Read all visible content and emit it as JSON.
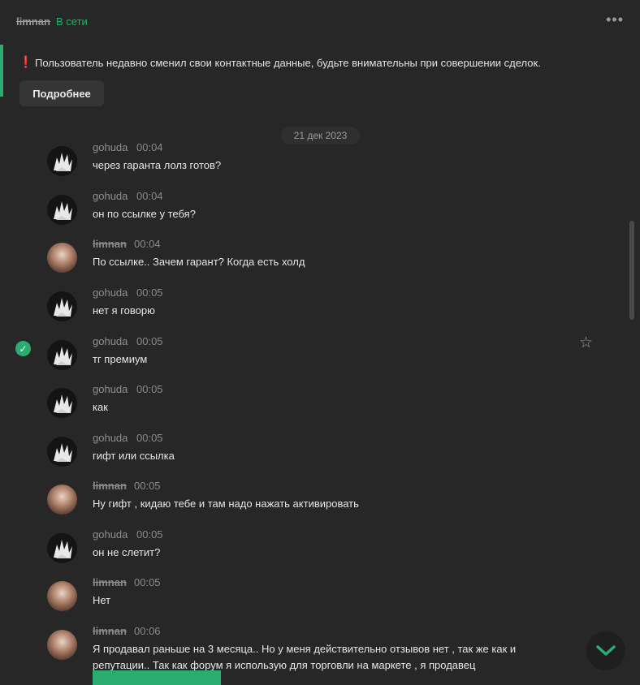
{
  "header": {
    "username": "limnan",
    "status": "В сети",
    "menu_icon": "more-dots-icon"
  },
  "notice": {
    "icon": "exclamation-icon",
    "text": "Пользователь недавно сменил свои контактные данные, будьте внимательны при совершении сделок.",
    "button_label": "Подробнее"
  },
  "date_separator": "21 дек 2023",
  "messages": [
    {
      "author": "gohuda",
      "time": "00:04",
      "text": "через гаранта лолз готов?"
    },
    {
      "author": "gohuda",
      "time": "00:04",
      "text": "он по ссылке у тебя?"
    },
    {
      "author": "limnan",
      "time": "00:04",
      "text": "По ссылке.. Зачем гарант? Когда есть холд"
    },
    {
      "author": "gohuda",
      "time": "00:05",
      "text": "нет я говорю"
    },
    {
      "author": "gohuda",
      "time": "00:05",
      "text": "тг премиум"
    },
    {
      "author": "gohuda",
      "time": "00:05",
      "text": "как"
    },
    {
      "author": "gohuda",
      "time": "00:05",
      "text": "гифт или ссылка"
    },
    {
      "author": "limnan",
      "time": "00:05",
      "text": "Ну гифт , кидаю тебе и там надо нажать активировать"
    },
    {
      "author": "gohuda",
      "time": "00:05",
      "text": "он не слетит?"
    },
    {
      "author": "limnan",
      "time": "00:05",
      "text": "Нет"
    },
    {
      "author": "limnan",
      "time": "00:06",
      "text": "Я продавал раньше на 3 месяца.. Но у меня действительно отзывов нет , так же как и репутации.. Так как форум я использую для торговли на маркете , я продавец"
    }
  ],
  "icons": {
    "read_check": "check-circle-icon",
    "favorite": "star-icon",
    "scroll_down": "chevron-down-icon"
  },
  "colors": {
    "background": "#272727",
    "accent": "#2bad72",
    "warning": "#e23b3b",
    "text": "#e6e6e6",
    "muted": "#8a8a8a"
  }
}
